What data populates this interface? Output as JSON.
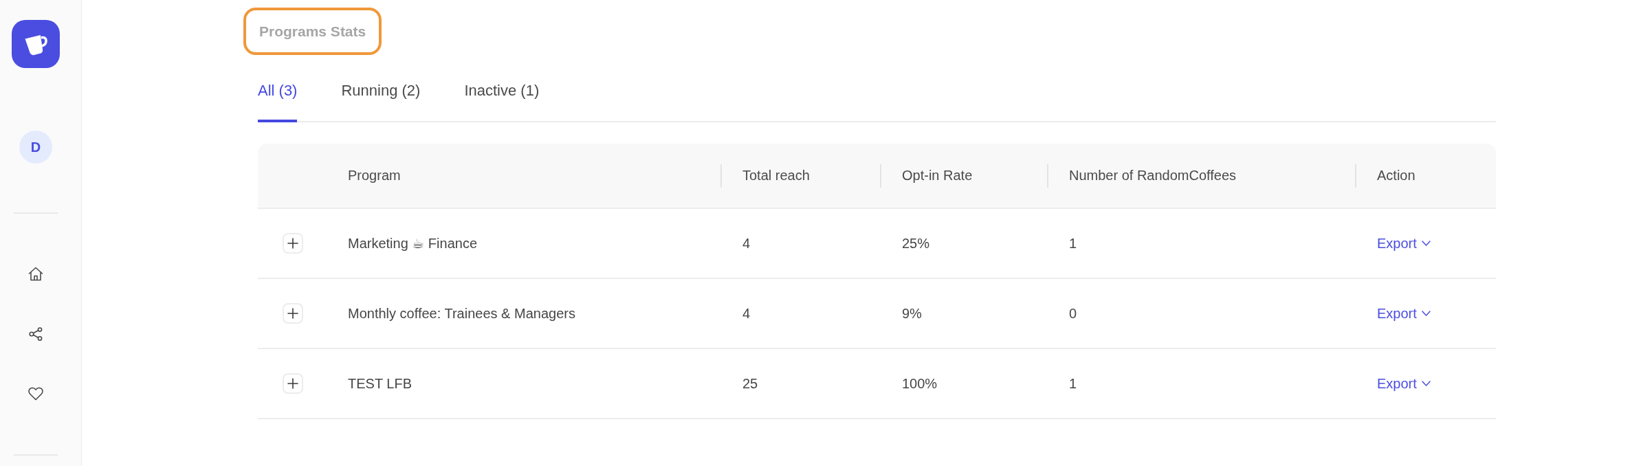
{
  "sidebar": {
    "avatar_initial": "D"
  },
  "header": {
    "title": "Programs Stats",
    "highlighted": true
  },
  "tabs": [
    {
      "label": "All (3)",
      "selected": true
    },
    {
      "label": "Running (2)",
      "selected": false
    },
    {
      "label": "Inactive (1)",
      "selected": false
    }
  ],
  "table": {
    "columns": [
      "Program",
      "Total reach",
      "Opt-in Rate",
      "Number of RandomCoffees",
      "Action"
    ],
    "rows": [
      {
        "expanded": false,
        "program": "Marketing ☕ Finance",
        "total_reach": "4",
        "opt_in_rate": "25%",
        "number_of_randomcoffees": "1",
        "action": "Export"
      },
      {
        "expanded": false,
        "program": "Monthly coffee: Trainees & Managers",
        "total_reach": "4",
        "opt_in_rate": "9%",
        "number_of_randomcoffees": "0",
        "action": "Export"
      },
      {
        "expanded": false,
        "program": "TEST LFB",
        "total_reach": "25",
        "opt_in_rate": "100%",
        "number_of_randomcoffees": "1",
        "action": "Export"
      }
    ]
  }
}
